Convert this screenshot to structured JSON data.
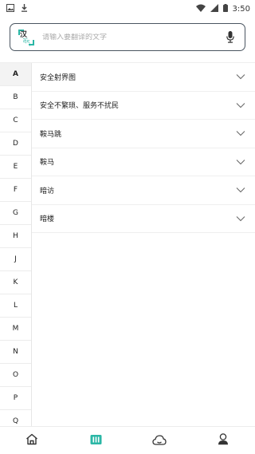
{
  "status_bar": {
    "time": "3:50",
    "left_icons": [
      "gallery-icon",
      "download-icon"
    ],
    "right_icons": [
      "wifi-icon",
      "signal-icon",
      "battery-icon"
    ]
  },
  "search": {
    "logo_glyph_zh": "汉",
    "logo_glyph_bo": "བོད",
    "placeholder": "请输入要翻译的文字",
    "mic_icon": "microphone-icon",
    "accent_color": "#2bb7a6"
  },
  "alphabet": {
    "active": "A",
    "letters": [
      "A",
      "B",
      "C",
      "D",
      "E",
      "F",
      "G",
      "H",
      "J",
      "K",
      "L",
      "M",
      "N",
      "O",
      "P",
      "Q"
    ]
  },
  "entries": [
    {
      "label": "安全射界图"
    },
    {
      "label": "安全不繁琐、服务不扰民"
    },
    {
      "label": "鞍马跳"
    },
    {
      "label": "鞍马"
    },
    {
      "label": "暗访"
    },
    {
      "label": "暗楼"
    }
  ],
  "bottom_nav": {
    "items": [
      {
        "icon": "home-icon",
        "active": false
      },
      {
        "icon": "book-icon",
        "active": true
      },
      {
        "icon": "cloud-icon",
        "active": false
      },
      {
        "icon": "user-icon",
        "active": false
      }
    ],
    "active_color": "#2bb7a6",
    "inactive_color": "#333333"
  }
}
